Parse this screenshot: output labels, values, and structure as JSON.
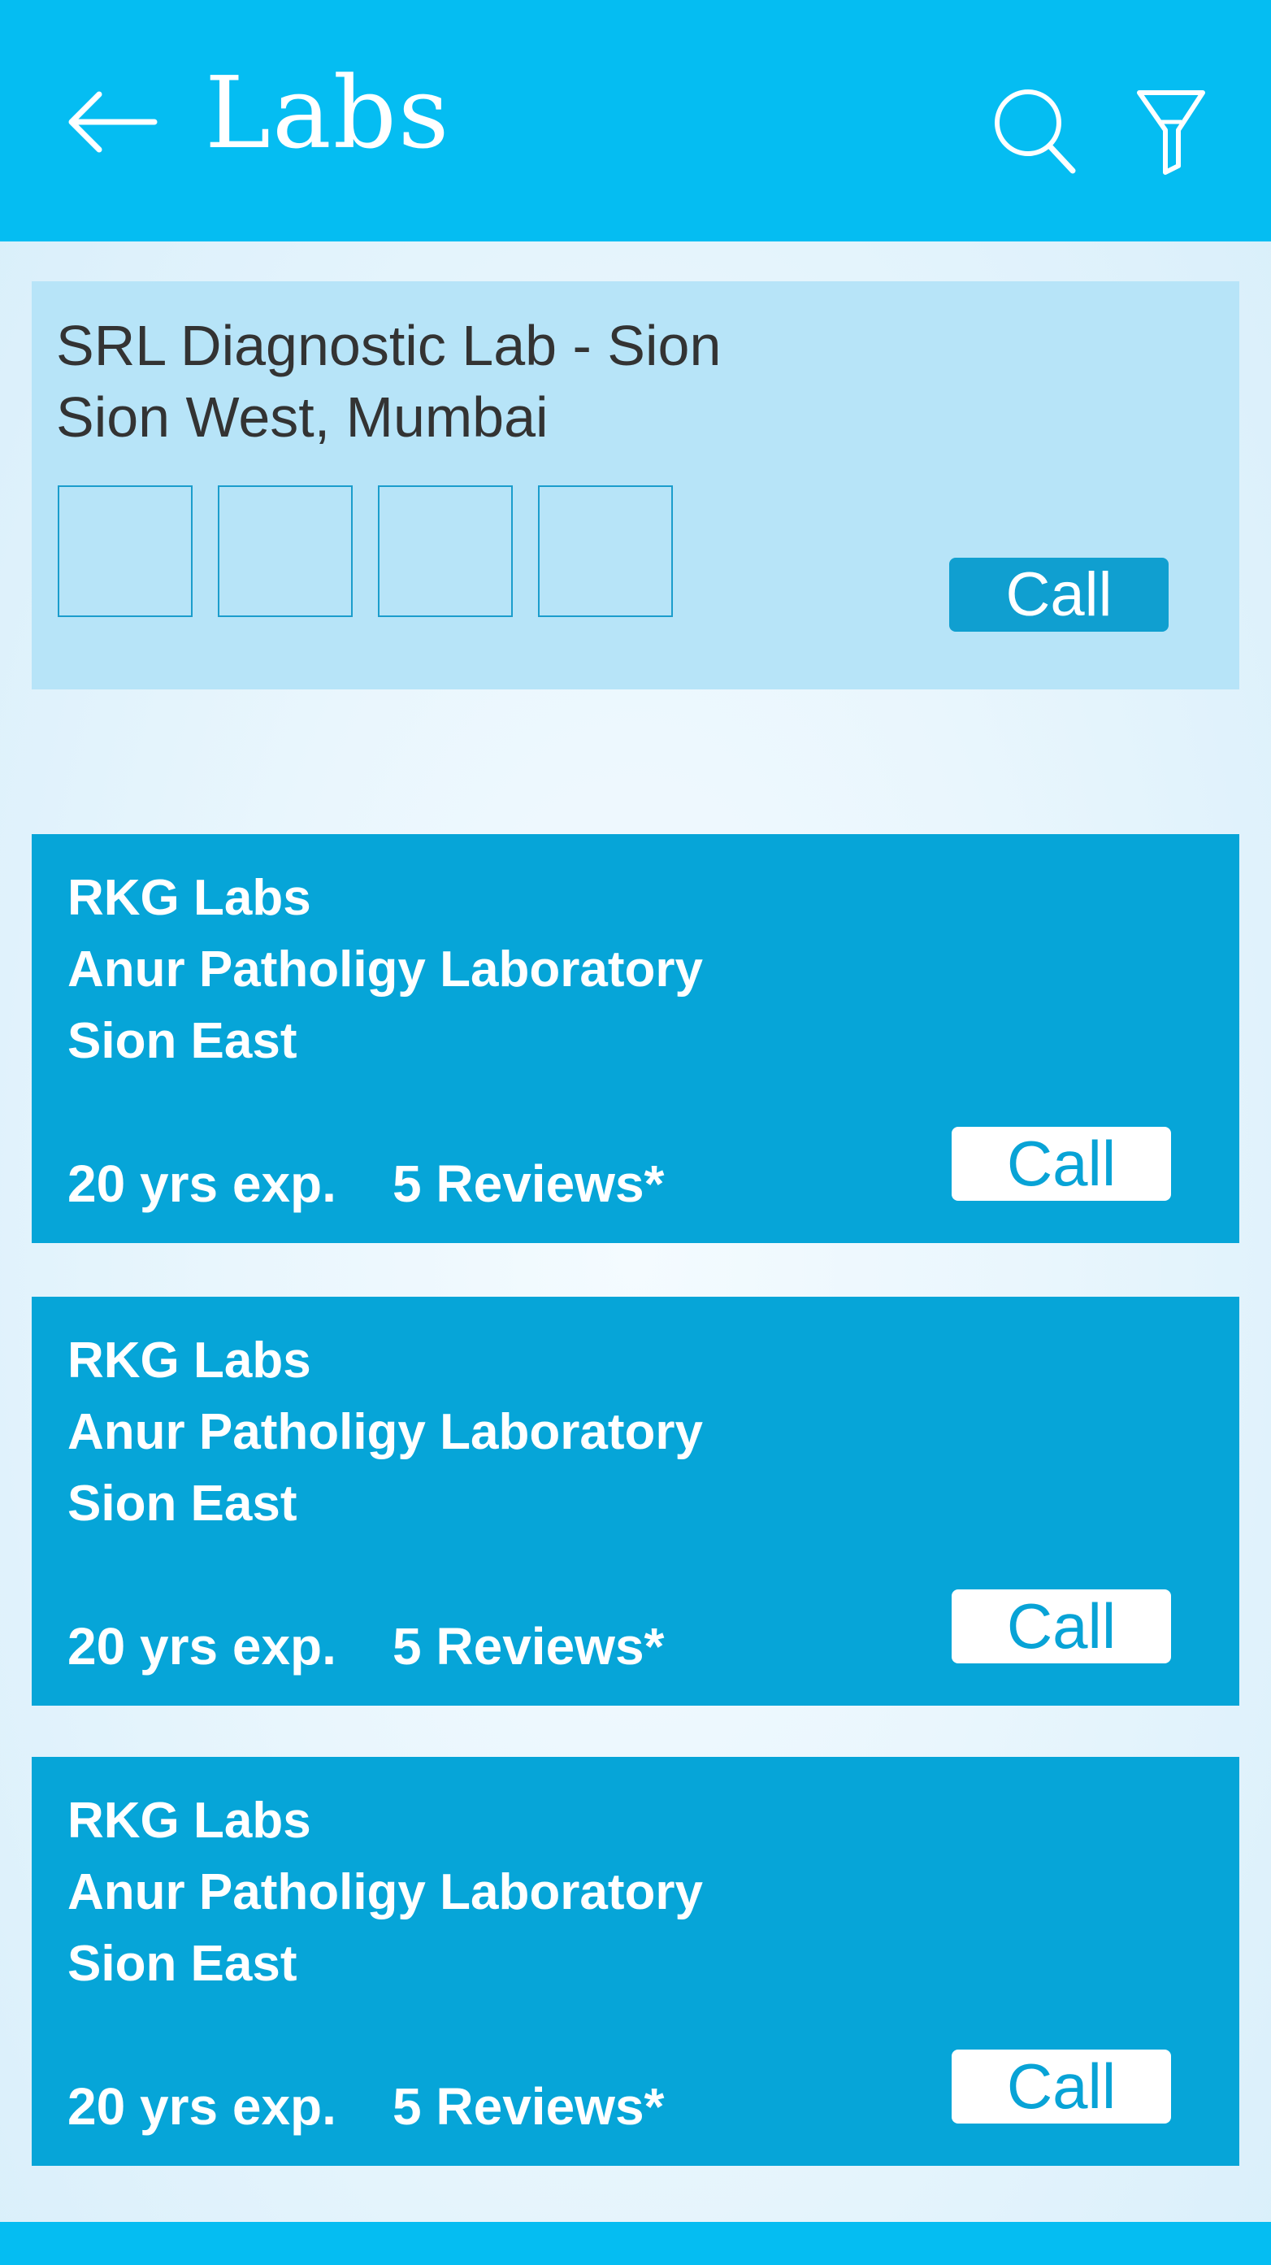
{
  "header": {
    "title": "Labs",
    "back_icon": "arrow-left-icon",
    "search_icon": "search-icon",
    "filter_icon": "filter-icon"
  },
  "featured": {
    "name": "SRL Diagnostic Lab - Sion",
    "location": "Sion West, Mumbai",
    "call_label": "Call"
  },
  "labs": [
    {
      "name": "RKG Labs",
      "subtitle": "Anur Patholigy Laboratory",
      "area": "Sion East",
      "experience": "20 yrs exp.",
      "reviews": "5 Reviews*",
      "call_label": "Call"
    },
    {
      "name": "RKG Labs",
      "subtitle": "Anur Patholigy Laboratory",
      "area": "Sion East",
      "experience": "20 yrs exp.",
      "reviews": "5 Reviews*",
      "call_label": "Call"
    },
    {
      "name": "RKG Labs",
      "subtitle": "Anur Patholigy Laboratory",
      "area": "Sion East",
      "experience": "20 yrs exp.",
      "reviews": "5 Reviews*",
      "call_label": "Call"
    }
  ],
  "colors": {
    "header": "#05bdf2",
    "featured_card": "#b7e4f8",
    "lab_card": "#06a5d8",
    "featured_call": "#109fd0",
    "thumb_border": "#1b9dcc"
  }
}
